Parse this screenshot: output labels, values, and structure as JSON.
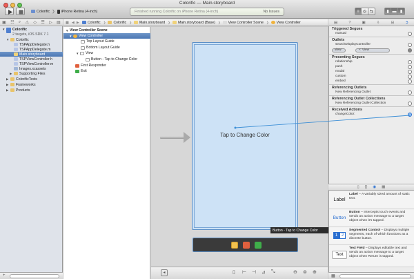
{
  "window": {
    "title": "Colorific — Main.storyboard"
  },
  "toolbar": {
    "scheme": "Colorific",
    "device": "iPhone Retina (4-inch)",
    "status": "Finished running Colorific on iPhone Retina (4-inch)",
    "issues": "No Issues"
  },
  "navigator": {
    "project_name": "Colorific",
    "project_sub": "2 targets, iOS SDK 7.1",
    "items": [
      "Colorific",
      "TSPAppDelegate.h",
      "TSPAppDelegate.m",
      "Main.storyboard",
      "TSPViewController.h",
      "TSPViewController.m",
      "Images.xcassets",
      "Supporting Files",
      "ColorificTests",
      "Frameworks",
      "Products"
    ]
  },
  "jumpbar": {
    "crumbs": [
      "Colorific",
      "Colorific",
      "Main.storyboard",
      "Main.storyboard (Base)",
      "View Controller Scene",
      "View Controller"
    ]
  },
  "outline": {
    "items": [
      "View Controller Scene",
      "View Controller",
      "Top Layout Guide",
      "Bottom Layout Guide",
      "View",
      "Button - Tap to Change Color",
      "First Responder",
      "Exit"
    ]
  },
  "canvas": {
    "button_title": "Tap to Change Color",
    "tooltip": "Button - Tap to Change Color"
  },
  "inspector": {
    "sections": [
      {
        "title": "Triggered Segues",
        "rows": [
          "manual"
        ]
      },
      {
        "title": "Outlets",
        "rows": [
          "searchDisplayController",
          "view"
        ],
        "view_target": "View"
      },
      {
        "title": "Presenting Segues",
        "rows": [
          "relationship",
          "push",
          "modal",
          "custom",
          "embed"
        ]
      },
      {
        "title": "Referencing Outlets",
        "rows": [
          "New Referencing Outlet"
        ]
      },
      {
        "title": "Referencing Outlet Collections",
        "rows": [
          "New Referencing Outlet Collection"
        ]
      },
      {
        "title": "Received Actions",
        "rows": [
          "changeColor:"
        ]
      }
    ]
  },
  "library": {
    "items": [
      {
        "icon": "Label",
        "name": "Label",
        "desc": " – A variably sized amount of static text."
      },
      {
        "icon": "Button",
        "name": "Button",
        "desc": " – Intercepts touch events and sends an action message to a target object when it's tapped."
      },
      {
        "icon_1": "1",
        "icon_2": "2",
        "name": "Segmented Control",
        "desc": " – Displays multiple segments, each of which functions as a discrete button."
      },
      {
        "icon": "Text",
        "name": "Text Field",
        "desc": " – Displays editable text and sends an action message to a target object when Return is tapped."
      }
    ]
  },
  "colors": {
    "selection": "#4a76b3",
    "scene_bg": "#cde2f6",
    "connection": "#3d8fd6"
  }
}
